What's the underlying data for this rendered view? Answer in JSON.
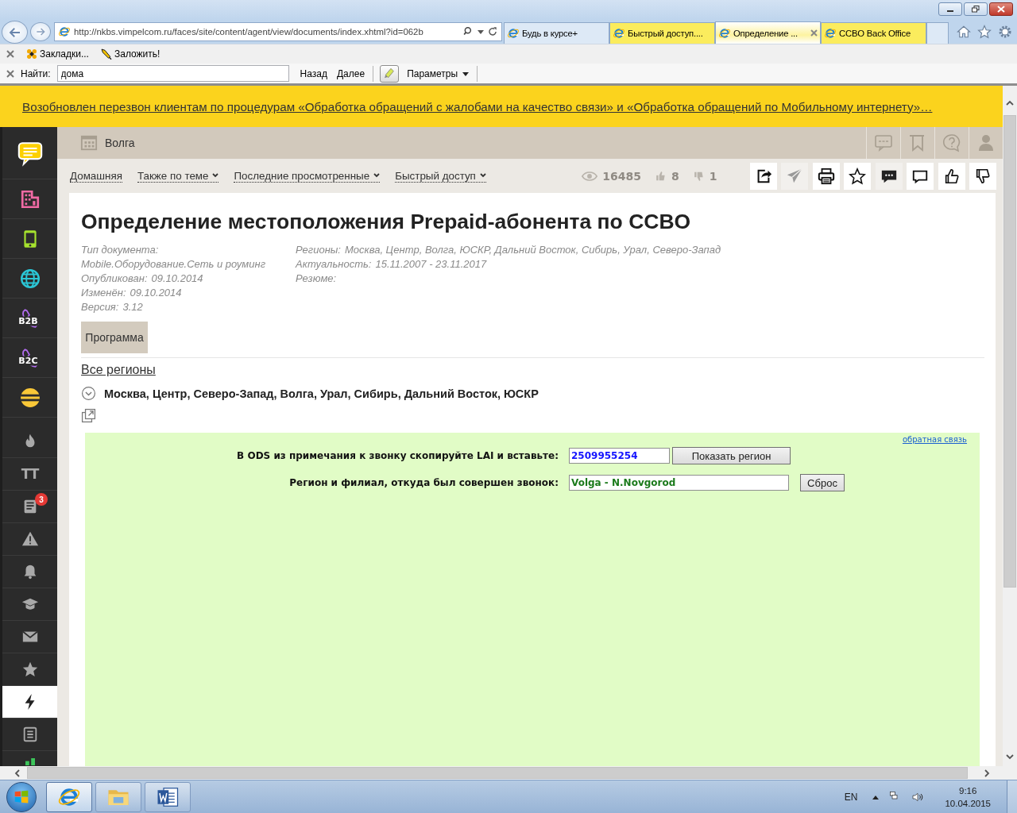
{
  "browser": {
    "address": "http://nkbs.vimpelcom.ru/faces/site/content/agent/view/documents/index.xhtml?id=062b",
    "tabs": [
      {
        "label": "Будь в курсе+",
        "selected": false,
        "color": "#dde9f6"
      },
      {
        "label": "Быстрый доступ....",
        "selected": false,
        "color": "#fbec5d"
      },
      {
        "label": "Определение ...",
        "selected": true,
        "color": "#fdf3a0"
      },
      {
        "label": "CCBO Back Office",
        "selected": false,
        "color": "#fbec5d"
      }
    ],
    "favorites": [
      "Закладки...",
      "Заложить!"
    ],
    "find": {
      "label": "Найти:",
      "value": "дома",
      "buttons": [
        "Назад",
        "Далее"
      ],
      "options": "Параметры"
    }
  },
  "announcement": "Возобновлен перезвон клиентам по процедурам «Обработка обращений с жалобами на качество связи» и «Обработка обращений по Мобильному интернету»…",
  "sidebar": {
    "primary": [
      {
        "kind": "chat",
        "selected": false
      },
      {
        "kind": "building",
        "selected": false
      },
      {
        "kind": "phone",
        "selected": false
      },
      {
        "kind": "globe",
        "selected": false
      },
      {
        "kind": "handset",
        "label": "B2B",
        "selected": false
      },
      {
        "kind": "handset",
        "label": "B2C",
        "selected": false
      },
      {
        "kind": "logo",
        "selected": false
      }
    ],
    "secondary": [
      {
        "kind": "fire",
        "selected": false
      },
      {
        "kind": "text",
        "label": "TT",
        "selected": false
      },
      {
        "kind": "news",
        "badge": "3",
        "selected": false
      },
      {
        "kind": "warning",
        "selected": false
      },
      {
        "kind": "bell",
        "selected": false
      },
      {
        "kind": "cap",
        "selected": false
      },
      {
        "kind": "mail",
        "selected": false
      },
      {
        "kind": "star",
        "selected": false
      },
      {
        "kind": "lightning",
        "selected": true
      },
      {
        "kind": "list",
        "selected": false
      },
      {
        "kind": "chart",
        "selected": false
      }
    ]
  },
  "header": {
    "region": "Волга",
    "tools": [
      {
        "kind": "sms"
      },
      {
        "kind": "bookmark"
      },
      {
        "kind": "help"
      },
      {
        "kind": "user"
      }
    ]
  },
  "nav": {
    "links": [
      {
        "label": "Домашняя",
        "dropdown": false
      },
      {
        "label": "Также по теме",
        "dropdown": true
      },
      {
        "label": "Последние просмотренные",
        "dropdown": true
      },
      {
        "label": "Быстрый доступ",
        "dropdown": true
      }
    ],
    "stats": [
      {
        "kind": "views",
        "value": "16485"
      },
      {
        "kind": "likes",
        "value": "8"
      },
      {
        "kind": "dislikes",
        "value": "1"
      }
    ],
    "actions": [
      {
        "kind": "share",
        "disabled": false
      },
      {
        "kind": "send",
        "disabled": true
      },
      {
        "kind": "print",
        "disabled": false
      },
      {
        "kind": "favorite",
        "disabled": false
      },
      {
        "kind": "comments",
        "disabled": true
      },
      {
        "kind": "comment",
        "disabled": false
      },
      {
        "kind": "like",
        "disabled": false
      },
      {
        "kind": "dislike",
        "disabled": false
      }
    ]
  },
  "document": {
    "title": "Определение местоположения Prepaid-абонента по CCBO",
    "meta_left": [
      {
        "label": "Тип документа:",
        "value": "Mobile.Оборудование.Сеть и роуминг",
        "kind": "stacked"
      },
      {
        "label": "Опубликован:",
        "value": "09.10.2014",
        "kind": "inline"
      },
      {
        "label": "Изменён:",
        "value": "09.10.2014",
        "kind": "inline"
      },
      {
        "label": "Версия:",
        "value": "3.12",
        "kind": "inline"
      }
    ],
    "meta_right": [
      {
        "label": "Регионы:",
        "value": "Москва, Центр, Волга, ЮСКР, Дальний Восток, Сибирь, Урал, Северо-Запад",
        "kind": "inline"
      },
      {
        "label": "Актуальность:",
        "value": "15.11.2007 - 23.11.2017",
        "kind": "inline"
      },
      {
        "label": "Резюме:",
        "kind": "inline"
      }
    ],
    "section_tab": "Программа",
    "all_regions": "Все регионы",
    "regions": "Москва, Центр, Северо-Запад, Волга, Урал, Сибирь, Дальний Восток, ЮСКР",
    "form": {
      "feedback": "обратная связь",
      "rows": [
        {
          "kind": "lookup",
          "label": "В ODS из примечания к звонку скопируйте LAI и вставьте:",
          "value": "2509955254",
          "button": "Показать регион"
        },
        {
          "kind": "result",
          "label": "Регион и филиал, откуда был совершен звонок:",
          "value": "Volga - N.Novgorod",
          "button": "Сброс"
        }
      ]
    }
  },
  "taskbar": {
    "apps": [
      {
        "kind": "ie",
        "selected": true
      },
      {
        "kind": "explorer",
        "selected": false
      },
      {
        "kind": "word",
        "selected": false
      }
    ],
    "language": "EN",
    "time": "9:16",
    "date": "10.04.2015"
  }
}
